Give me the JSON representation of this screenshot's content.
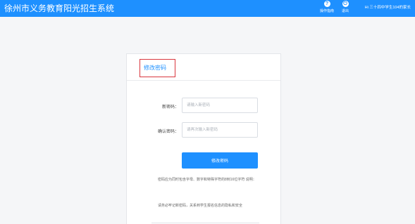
{
  "header": {
    "title": "徐州市义务教育阳光招生系统",
    "help_label": "操作指南",
    "help_icon_glyph": "?",
    "logout_label": "退出",
    "logout_icon_glyph": "⏻",
    "greeting": "Hi 三十四中学生104的家长",
    "brand_color": "#1e90ff"
  },
  "form": {
    "title": "修改密码",
    "new_password_label": "新密码：",
    "new_password_placeholder": "请输入新密码",
    "confirm_password_label": "确认密码：",
    "confirm_password_placeholder": "请再次输入新密码",
    "submit_label": "修改密码",
    "hint_1": "密码应为同时包含字母、数字和特殊字符的8到16位字符 说明：",
    "hint_2": "请务必牢记新密码，关系到学生报名信息的隐私和安全"
  }
}
